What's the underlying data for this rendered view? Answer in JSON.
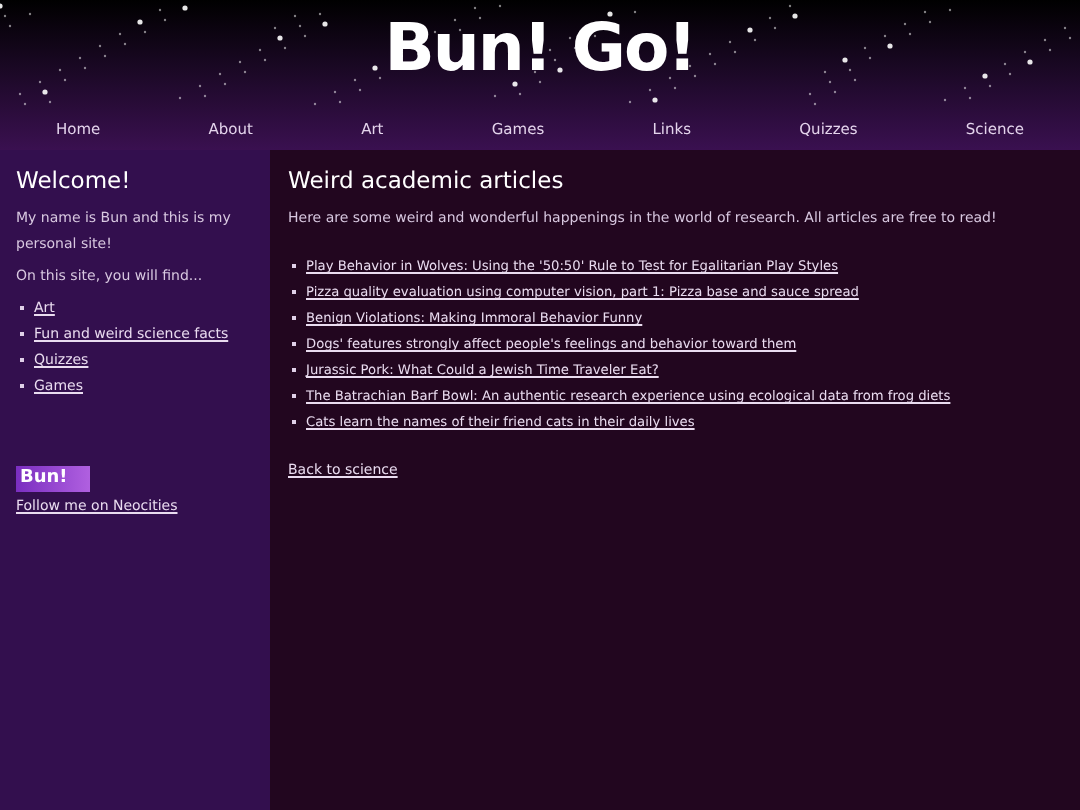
{
  "header": {
    "title": "Bun! Go!"
  },
  "nav": [
    "Home",
    "About",
    "Art",
    "Games",
    "Links",
    "Quizzes",
    "Science"
  ],
  "sidebar": {
    "heading": "Welcome!",
    "intro": "My name is Bun and this is my personal site!",
    "lead": "On this site, you will find...",
    "links": [
      "Art",
      "Fun and weird science facts",
      "Quizzes",
      "Games"
    ],
    "badge": "Bun!",
    "follow": "Follow me on Neocities"
  },
  "content": {
    "heading": "Weird academic articles",
    "intro": "Here are some weird and wonderful happenings in the world of research. All articles are free to read!",
    "articles": [
      "Play Behavior in Wolves: Using the '50:50' Rule to Test for Egalitarian Play Styles",
      "Pizza quality evaluation using computer vision, part 1: Pizza base and sauce spread",
      "Benign Violations: Making Immoral Behavior Funny",
      "Dogs' features strongly affect people's feelings and behavior toward them",
      "Jurassic Pork: What Could a Jewish Time Traveler Eat?",
      "The Batrachian Barf Bowl: An authentic research experience using ecological data from frog diets",
      "Cats learn the names of their friend cats in their daily lives"
    ],
    "back": "Back to science"
  }
}
